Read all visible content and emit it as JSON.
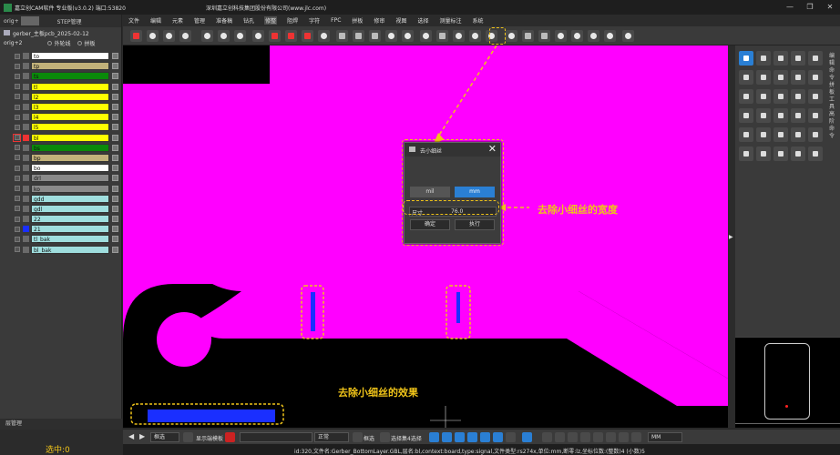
{
  "app": {
    "title": "嘉立创CAM软件 专业版(v3.0.2) 端口:53820",
    "company": "深圳嘉立创科技集团股份有限公司(www.jlc.com)"
  },
  "window_controls": [
    "—",
    "❐",
    "✕"
  ],
  "menu": [
    "文件",
    "编辑",
    "元素",
    "管理",
    "准备稿",
    "钻孔",
    "修整",
    "阻焊",
    "字符",
    "FPC",
    "拼板",
    "修审",
    "视图",
    "选择",
    "测量标注",
    "系统"
  ],
  "menu_active": "修整",
  "left_panel": {
    "step_label": "orig+",
    "step_manager": "STEP管理",
    "job_name": "gerber_主板pcb_2025-02-12",
    "orig_label": "orig+2",
    "outer_line": "外轮线",
    "panel_opt": "拼板",
    "layers": [
      {
        "name": "to",
        "color": "#ffffff"
      },
      {
        "name": "tp",
        "color": "#c2b27a"
      },
      {
        "name": "ts",
        "color": "#0a8a0a"
      },
      {
        "name": "tl",
        "color": "#ffff00"
      },
      {
        "name": "l2",
        "color": "#ffff00"
      },
      {
        "name": "l3",
        "color": "#ffff00"
      },
      {
        "name": "l4",
        "color": "#ffff00"
      },
      {
        "name": "l5",
        "color": "#ffff00"
      },
      {
        "name": "bl",
        "color": "#ffff00"
      },
      {
        "name": "bs",
        "color": "#0a8a0a"
      },
      {
        "name": "bp",
        "color": "#c2b27a"
      },
      {
        "name": "bo",
        "color": "#ffffff"
      },
      {
        "name": "drl",
        "color": "#8a8a8a"
      },
      {
        "name": "ko",
        "color": "#8a8a8a"
      },
      {
        "name": "gdd",
        "color": "#9fdede"
      },
      {
        "name": "gdl",
        "color": "#9fdede"
      },
      {
        "name": "22",
        "color": "#9fdede"
      },
      {
        "name": "21",
        "color": "#9fdede"
      },
      {
        "name": "tl_bak",
        "color": "#9fdede"
      },
      {
        "name": "bl_bak",
        "color": "#9fdede"
      }
    ],
    "layer_manager": "层管理",
    "selected_count": "选中:0"
  },
  "dialog": {
    "title": "去小细丝",
    "unit_mil": "mil",
    "unit_mm": "mm",
    "size_label": "尺寸",
    "size_value": "76.0",
    "confirm": "确定",
    "execute": "执行"
  },
  "annotations": {
    "width_note": "去除小细丝的宽度",
    "effect_note": "去除小细丝的效果"
  },
  "right_panel": {
    "side_labels": [
      "编辑命令",
      "拼板工具",
      "高阶命令"
    ]
  },
  "bottom_bar": {
    "mode": "框选",
    "display_mode": "显示端模板",
    "view": "正常",
    "option1": "框选",
    "option2": "选择集4选择",
    "unit": "MM"
  },
  "status": {
    "text": "id:320,文件名:Gerber_BottomLayer.GBL,层名:bl,context:board,type:signal,文件类型:rs274x,单位:mm,断零:lz,坐标位数:(整数)4 (小数)5"
  }
}
